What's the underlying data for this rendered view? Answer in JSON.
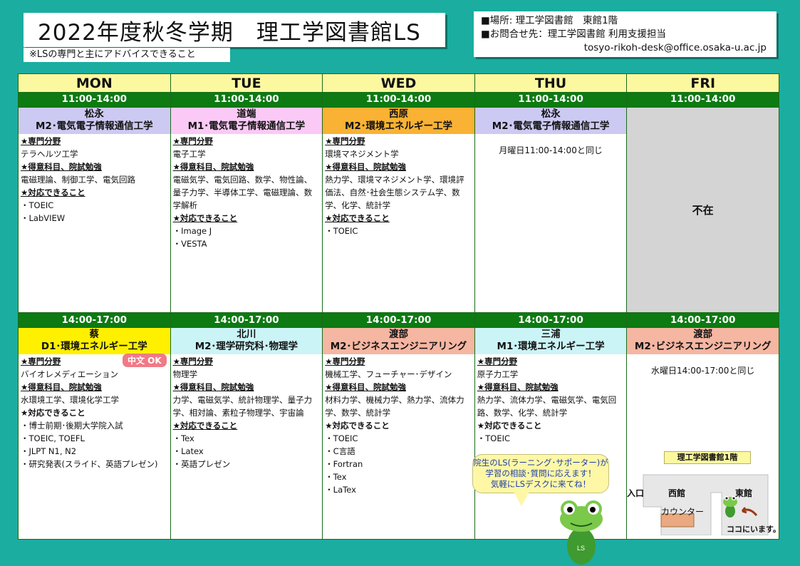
{
  "header": {
    "title": "2022年度秋冬学期　理工学図書館LS",
    "subtitle": "※LSの専門と主にアドバイスできること",
    "location": "■場所: 理工学図書館　東館1階",
    "contact": "■お問合せ先：理工学図書館 利用支援担当",
    "email": "tosyo-rikoh-desk@office.osaka-u.ac.jp"
  },
  "days": [
    "MON",
    "TUE",
    "WED",
    "THU",
    "FRI"
  ],
  "slot1": {
    "time": "11:00-14:00",
    "cells": [
      {
        "name": "松永",
        "dept": "M2･電気電子情報通信工学",
        "specialty_label": "★専門分野",
        "specialty": "テラヘルツ工学",
        "subjects_label": "★得意科目、院試勉強",
        "subjects": "電磁理論、制御工学、電気回路",
        "support_label": "★対応できること",
        "support": [
          "・TOEIC",
          "・LabVIEW"
        ]
      },
      {
        "name": "道端",
        "dept": "M1･電気電子情報通信工学",
        "specialty_label": "★専門分野",
        "specialty": "電子工学",
        "subjects_label": "★得意科目、院試勉強",
        "subjects": "電磁気学、電気回路、数学、物性論、量子力学、半導体工学、電磁理論、数学解析",
        "support_label": "★対応できること",
        "support": [
          "・Image J",
          "・VESTA"
        ]
      },
      {
        "name": "西原",
        "dept": "M2･環境エネルギー工学",
        "specialty_label": "★専門分野",
        "specialty": "環境マネジメント学",
        "subjects_label": "★得意科目、院試勉強",
        "subjects": "熱力学、環境マネジメント学、環境評価法、自然･社会生態システム学、数学、化学、統計学",
        "support_label": "★対応できること",
        "support": [
          "・TOEIC"
        ]
      },
      {
        "name": "松永",
        "dept": "M2･電気電子情報通信工学",
        "same_note": "月曜日11:00-14:00と同じ"
      },
      {
        "absent": "不在"
      }
    ]
  },
  "slot2": {
    "time": "14:00-17:00",
    "cells": [
      {
        "name": "蔡",
        "dept": "D1･環境エネルギー工学",
        "badge": "中文 OK",
        "specialty_label": "★専門分野",
        "specialty": "バイオレメディエーション",
        "subjects_label": "★得意科目、院試勉強",
        "subjects": "水環境工学、環境化学工学",
        "support_label": "★対応できること",
        "support": [
          "・博士前期･後期大学院入試",
          "・TOEIC, TOEFL",
          "・JLPT N1, N2",
          "・研究発表(スライド、英語プレゼン)"
        ]
      },
      {
        "name": "北川",
        "dept": "M2･理学研究科･物理学",
        "specialty_label": "★専門分野",
        "specialty": "物理学",
        "subjects_label": "★得意科目、院試勉強",
        "subjects": "力学、電磁気学、統計物理学、量子力学、相対論、素粒子物理学、宇宙論",
        "support_label": "★対応できること",
        "support": [
          "・Tex",
          "・Latex",
          "・英語プレゼン"
        ]
      },
      {
        "name": "渡部",
        "dept": "M2･ビジネスエンジニアリング",
        "specialty_label": "★専門分野",
        "specialty": "機械工学、フューチャー･デザイン",
        "subjects_label": "★得意科目、院試勉強",
        "subjects": "材料力学、機械力学、熱力学、流体力学、数学、統計学",
        "support_label": "★対応できること",
        "support": [
          "・TOEIC",
          "・C言語",
          "・Fortran",
          "・Tex",
          "・LaTex"
        ]
      },
      {
        "name": "三浦",
        "dept": "M1･環境エネルギー工学",
        "specialty_label": "★専門分野",
        "specialty": "原子力工学",
        "subjects_label": "★得意科目、院試勉強",
        "subjects": "熱力学、流体力学、電磁気学、電気回路、数学、化学、統計学",
        "support_label": "★対応できること",
        "support": [
          "・TOEIC"
        ]
      },
      {
        "name": "渡部",
        "dept": "M2･ビジネスエンジニアリング",
        "same_note": "水曜日14:00-17:00と同じ"
      }
    ]
  },
  "bubble": {
    "line1": "院生のLS(ラーニング･サポーター)が",
    "line2": "学習の相談･質問に応えます！",
    "line3": "気軽にLSデスクに来てね！"
  },
  "map": {
    "title": "理工学図書館1階",
    "entrance": "入口",
    "west": "西館",
    "east": "東館",
    "counter": "カウンター",
    "here": "ココにいます。"
  },
  "colors": {
    "background": "#1aada0",
    "time_header": "#0d7a12",
    "day_header": "#fcf8a0"
  }
}
